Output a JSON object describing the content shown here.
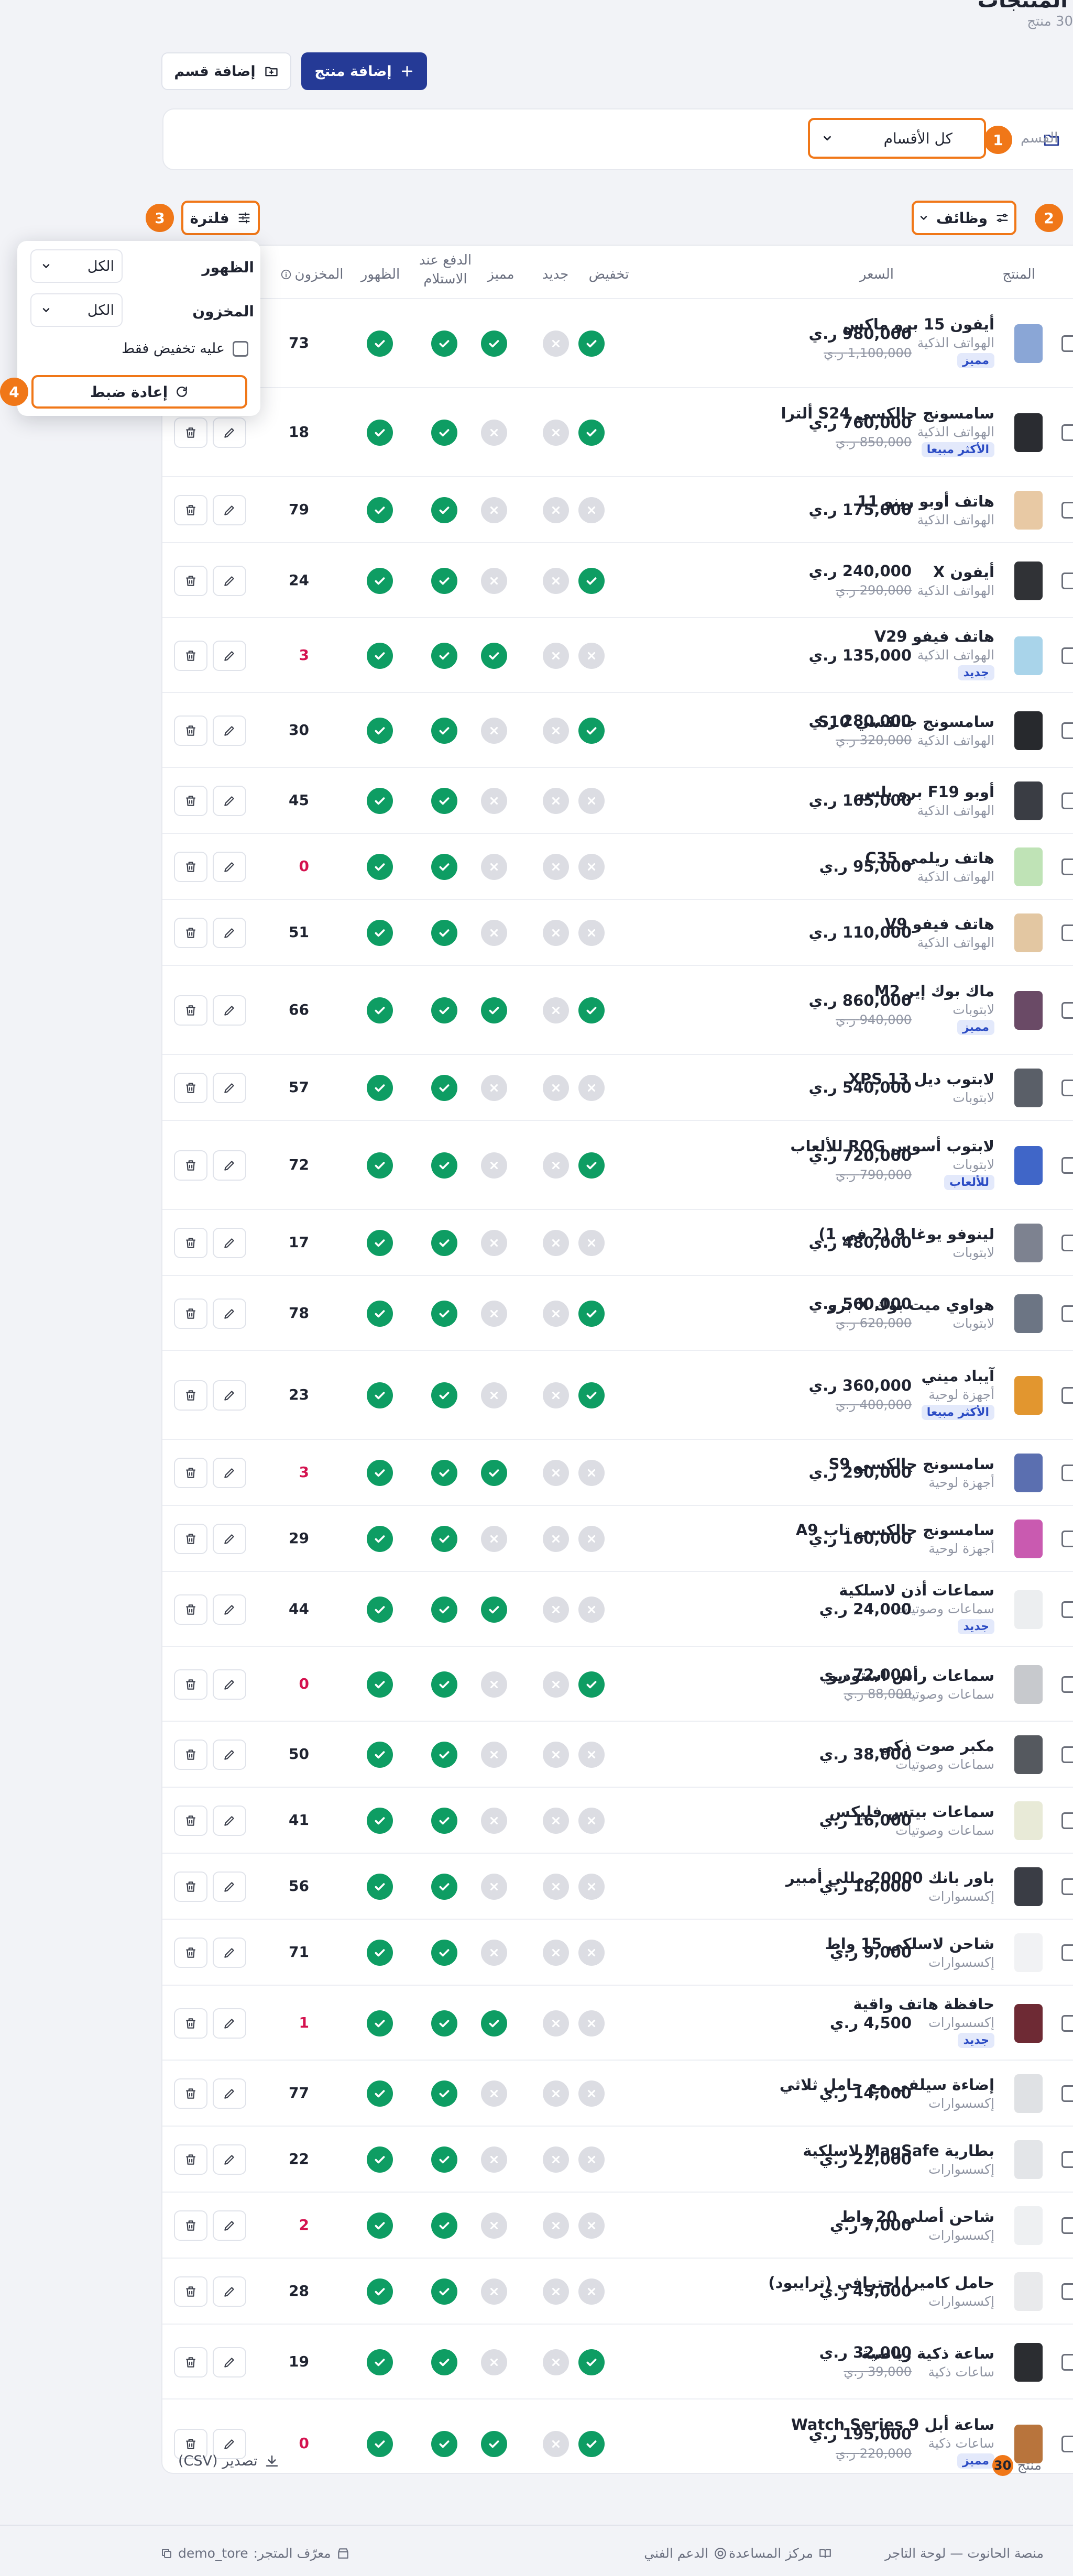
{
  "header": {
    "title": "المنتجات",
    "count_text": "30 منتج"
  },
  "toolbar": {
    "add_product": "إضافة منتج",
    "add_category": "إضافة قسم"
  },
  "category_filter": {
    "label": "القسم",
    "selected": "كل الأقسام"
  },
  "actions_bar": {
    "functions": "وظائف",
    "filter": "فلترة"
  },
  "tour_badges": {
    "b1": "1",
    "b2": "2",
    "b3": "3",
    "b4": "4"
  },
  "columns": {
    "product": "المنتج",
    "price": "السعر",
    "discount": "تخفيض",
    "new": "جديد",
    "featured": "مميز",
    "cod": "الدفع عند الاستلام",
    "visible": "الظهور",
    "stock": "المخزون"
  },
  "filter_panel": {
    "visibility_label": "الظهور",
    "visibility_value": "الكل",
    "stock_label": "المخزون",
    "stock_value": "الكل",
    "discount_only": "عليه تخفيض فقط",
    "reset": "إعادة ضبط"
  },
  "currency": "ر.ي",
  "colors": {
    "accent": "#253a96",
    "highlight": "#f07718",
    "on": "#0e9d63",
    "off": "#dcdde3",
    "low_stock": "#d4124f"
  },
  "tag_styles": {
    "مميز": {
      "bg": "#e3e9fb",
      "fg": "#2c4cc4"
    },
    "الأكثر مبيعا": {
      "bg": "#e3e9fb",
      "fg": "#2c4cc4"
    },
    "جديد": {
      "bg": "#e3e9fb",
      "fg": "#2c4cc4"
    },
    "للألعاب": {
      "bg": "#e3e9fb",
      "fg": "#2c4cc4"
    }
  },
  "products": [
    {
      "name": "أيفون 15 برو ماكس",
      "category": "الهواتف الذكية",
      "tag": "مميز",
      "price": "980,000",
      "old_price": "1,100,000",
      "discount": true,
      "new": false,
      "featured": true,
      "cod": true,
      "visible": true,
      "stock": "73",
      "low": false,
      "thumb": "#8aa6d6"
    },
    {
      "name": "سامسونج جالكسي S24 ألترا",
      "category": "الهواتف الذكية",
      "tag": "الأكثر مبيعا",
      "price": "760,000",
      "old_price": "850,000",
      "discount": true,
      "new": false,
      "featured": false,
      "cod": true,
      "visible": true,
      "stock": "18",
      "low": false,
      "thumb": "#2a2c31"
    },
    {
      "name": "هاتف أوبو رينو 11",
      "category": "الهواتف الذكية",
      "tag": "",
      "price": "175,000",
      "old_price": "",
      "discount": false,
      "new": false,
      "featured": false,
      "cod": true,
      "visible": true,
      "stock": "79",
      "low": false,
      "thumb": "#e8c9a4"
    },
    {
      "name": "أيفون X",
      "category": "الهواتف الذكية",
      "tag": "",
      "price": "240,000",
      "old_price": "290,000",
      "discount": true,
      "new": false,
      "featured": false,
      "cod": true,
      "visible": true,
      "stock": "24",
      "low": false,
      "thumb": "#303236"
    },
    {
      "name": "هاتف فيفو V29",
      "category": "الهواتف الذكية",
      "tag": "جديد",
      "price": "135,000",
      "old_price": "",
      "discount": false,
      "new": false,
      "featured": true,
      "cod": true,
      "visible": true,
      "stock": "3",
      "low": true,
      "thumb": "#a9d4ea"
    },
    {
      "name": "سامسونج جالكسي S10",
      "category": "الهواتف الذكية",
      "tag": "",
      "price": "280,000",
      "old_price": "320,000",
      "discount": true,
      "new": false,
      "featured": false,
      "cod": true,
      "visible": true,
      "stock": "30",
      "low": false,
      "thumb": "#27292d"
    },
    {
      "name": "أوبو F19 برو بلس",
      "category": "الهواتف الذكية",
      "tag": "",
      "price": "165,000",
      "old_price": "",
      "discount": false,
      "new": false,
      "featured": false,
      "cod": true,
      "visible": true,
      "stock": "45",
      "low": false,
      "thumb": "#3a3d44"
    },
    {
      "name": "هاتف ريلمي C35",
      "category": "الهواتف الذكية",
      "tag": "",
      "price": "95,000",
      "old_price": "",
      "discount": false,
      "new": false,
      "featured": false,
      "cod": true,
      "visible": true,
      "stock": "0",
      "low": true,
      "thumb": "#bfe3b6"
    },
    {
      "name": "هاتف فيفو V9",
      "category": "الهواتف الذكية",
      "tag": "",
      "price": "110,000",
      "old_price": "",
      "discount": false,
      "new": false,
      "featured": false,
      "cod": true,
      "visible": true,
      "stock": "51",
      "low": false,
      "thumb": "#e3c7a2"
    },
    {
      "name": "ماك بوك إير M2",
      "category": "لابتوبات",
      "tag": "مميز",
      "price": "860,000",
      "old_price": "940,000",
      "discount": true,
      "new": false,
      "featured": true,
      "cod": true,
      "visible": true,
      "stock": "66",
      "low": false,
      "thumb": "#6a4a66"
    },
    {
      "name": "لابتوب ديل XPS 13",
      "category": "لابتوبات",
      "tag": "",
      "price": "540,000",
      "old_price": "",
      "discount": false,
      "new": false,
      "featured": false,
      "cod": true,
      "visible": true,
      "stock": "57",
      "low": false,
      "thumb": "#5a5f68"
    },
    {
      "name": "لابتوب أسوس ROG للألعاب",
      "category": "لابتوبات",
      "tag": "للألعاب",
      "price": "720,000",
      "old_price": "790,000",
      "discount": true,
      "new": false,
      "featured": false,
      "cod": true,
      "visible": true,
      "stock": "72",
      "low": false,
      "thumb": "#4066c8"
    },
    {
      "name": "لينوفو يوغا 9 (2 في 1)",
      "category": "لابتوبات",
      "tag": "",
      "price": "480,000",
      "old_price": "",
      "discount": false,
      "new": false,
      "featured": false,
      "cod": true,
      "visible": true,
      "stock": "17",
      "low": false,
      "thumb": "#7d8290"
    },
    {
      "name": "هواوي ميت بوك X برو",
      "category": "لابتوبات",
      "tag": "",
      "price": "560,000",
      "old_price": "620,000",
      "discount": true,
      "new": false,
      "featured": false,
      "cod": true,
      "visible": true,
      "stock": "78",
      "low": false,
      "thumb": "#6c7584"
    },
    {
      "name": "آيباد ميني",
      "category": "أجهزة لوحية",
      "tag": "الأكثر مبيعا",
      "price": "360,000",
      "old_price": "400,000",
      "discount": true,
      "new": false,
      "featured": false,
      "cod": true,
      "visible": true,
      "stock": "23",
      "low": false,
      "thumb": "#e2962f"
    },
    {
      "name": "سامسونج جالكسي S9",
      "category": "أجهزة لوحية",
      "tag": "",
      "price": "290,000",
      "old_price": "",
      "discount": false,
      "new": false,
      "featured": true,
      "cod": true,
      "visible": true,
      "stock": "3",
      "low": true,
      "thumb": "#5b6fb0"
    },
    {
      "name": "سامسونج جالكسي تاب A9",
      "category": "أجهزة لوحية",
      "tag": "",
      "price": "160,000",
      "old_price": "",
      "discount": false,
      "new": false,
      "featured": false,
      "cod": true,
      "visible": true,
      "stock": "29",
      "low": false,
      "thumb": "#c95ab0"
    },
    {
      "name": "سماعات أذن لاسلكية",
      "category": "سماعات وصوتيات",
      "tag": "جديد",
      "price": "24,000",
      "old_price": "",
      "discount": false,
      "new": false,
      "featured": true,
      "cod": true,
      "visible": true,
      "stock": "44",
      "low": false,
      "thumb": "#eceef0"
    },
    {
      "name": "سماعات رأس استوديو",
      "category": "سماعات وصوتيات",
      "tag": "",
      "price": "72,000",
      "old_price": "88,000",
      "discount": true,
      "new": false,
      "featured": false,
      "cod": true,
      "visible": true,
      "stock": "0",
      "low": true,
      "thumb": "#c7c9cd"
    },
    {
      "name": "مكبر صوت ذكي",
      "category": "سماعات وصوتيات",
      "tag": "",
      "price": "38,000",
      "old_price": "",
      "discount": false,
      "new": false,
      "featured": false,
      "cod": true,
      "visible": true,
      "stock": "50",
      "low": false,
      "thumb": "#55595f"
    },
    {
      "name": "سماعات بيتس فليكس",
      "category": "سماعات وصوتيات",
      "tag": "",
      "price": "16,000",
      "old_price": "",
      "discount": false,
      "new": false,
      "featured": false,
      "cod": true,
      "visible": true,
      "stock": "41",
      "low": false,
      "thumb": "#e8ead7"
    },
    {
      "name": "باور بانك 20000 مللي أمبير",
      "category": "إكسسوارات",
      "tag": "",
      "price": "18,000",
      "old_price": "",
      "discount": false,
      "new": false,
      "featured": false,
      "cod": true,
      "visible": true,
      "stock": "56",
      "low": false,
      "thumb": "#3a3d45"
    },
    {
      "name": "شاحن لاسلكي 15 واط",
      "category": "إكسسوارات",
      "tag": "",
      "price": "9,000",
      "old_price": "",
      "discount": false,
      "new": false,
      "featured": false,
      "cod": true,
      "visible": true,
      "stock": "71",
      "low": false,
      "thumb": "#f1f2f4"
    },
    {
      "name": "حافظة هاتف واقية",
      "category": "إكسسوارات",
      "tag": "جديد",
      "price": "4,500",
      "old_price": "",
      "discount": false,
      "new": false,
      "featured": true,
      "cod": true,
      "visible": true,
      "stock": "1",
      "low": true,
      "thumb": "#6e2a34"
    },
    {
      "name": "إضاءة سيلفي مع حامل ثلاثي",
      "category": "إكسسوارات",
      "tag": "",
      "price": "14,000",
      "old_price": "",
      "discount": false,
      "new": false,
      "featured": false,
      "cod": true,
      "visible": true,
      "stock": "77",
      "low": false,
      "thumb": "#dfe1e4"
    },
    {
      "name": "بطارية MagSafe لاسلكية",
      "category": "إكسسوارات",
      "tag": "",
      "price": "22,000",
      "old_price": "",
      "discount": false,
      "new": false,
      "featured": false,
      "cod": true,
      "visible": true,
      "stock": "22",
      "low": false,
      "thumb": "#e3e5e8"
    },
    {
      "name": "شاحن أصلي 20 واط",
      "category": "إكسسوارات",
      "tag": "",
      "price": "7,000",
      "old_price": "",
      "discount": false,
      "new": false,
      "featured": false,
      "cod": true,
      "visible": true,
      "stock": "2",
      "low": true,
      "thumb": "#eef0f2"
    },
    {
      "name": "حامل كاميرا احترافي (ترايبود)",
      "category": "إكسسوارات",
      "tag": "",
      "price": "45,000",
      "old_price": "",
      "discount": false,
      "new": false,
      "featured": false,
      "cod": true,
      "visible": true,
      "stock": "28",
      "low": false,
      "thumb": "#e9eaec"
    },
    {
      "name": "ساعة ذكية رياضية",
      "category": "ساعات ذكية",
      "tag": "",
      "price": "32,000",
      "old_price": "39,000",
      "discount": true,
      "new": false,
      "featured": false,
      "cod": true,
      "visible": true,
      "stock": "19",
      "low": false,
      "thumb": "#2b2d31"
    },
    {
      "name": "ساعة أبل Watch Series 9",
      "category": "ساعات ذكية",
      "tag": "مميز",
      "price": "195,000",
      "old_price": "220,000",
      "discount": true,
      "new": false,
      "featured": true,
      "cod": true,
      "visible": true,
      "stock": "0",
      "low": true,
      "thumb": "#b8743c"
    }
  ],
  "footer": {
    "count_number": "30",
    "count_label": "منتج",
    "export": "تصدير (CSV)"
  },
  "bottom_bar": {
    "brand": "منصة الحانوت — لوحة التاجر",
    "help": "مركز المساعدة",
    "support": "الدعم الفني",
    "store_id_label": "معرّف المتجر:",
    "store_id": "demo_tore"
  }
}
